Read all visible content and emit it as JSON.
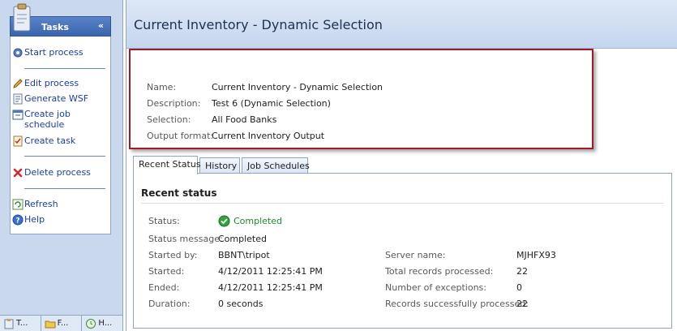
{
  "tasks": {
    "title": "Tasks",
    "collapse_glyph": "«",
    "items": [
      {
        "label": "Start process",
        "icon": "gear-icon"
      },
      {
        "label": "Edit process",
        "icon": "pencil-icon"
      },
      {
        "label": "Generate WSF",
        "icon": "script-icon"
      },
      {
        "label": "Create job",
        "label2": "schedule",
        "icon": "calendar-icon"
      },
      {
        "label": "Create task",
        "icon": "task-icon"
      },
      {
        "label": "Delete process",
        "icon": "delete-icon"
      },
      {
        "label": "Refresh",
        "icon": "refresh-icon"
      },
      {
        "label": "Help",
        "icon": "help-icon"
      }
    ]
  },
  "bottom_tabs": [
    {
      "label": "T..."
    },
    {
      "label": "F..."
    },
    {
      "label": "H..."
    }
  ],
  "main": {
    "title": "Current Inventory - Dynamic Selection",
    "properties": [
      {
        "key": "Name:",
        "value": "Current Inventory - Dynamic Selection"
      },
      {
        "key": "Description:",
        "value": "Test 6 (Dynamic Selection)"
      },
      {
        "key": "Selection:",
        "value": "All Food Banks"
      },
      {
        "key": "Output format:",
        "value": "Current Inventory Output"
      }
    ],
    "tabs": [
      {
        "label": "Recent Status"
      },
      {
        "label": "History"
      },
      {
        "label": "Job Schedules"
      }
    ],
    "recent": {
      "heading": "Recent status",
      "status_label": "Status:",
      "status_value": "Completed",
      "status_message_label": "Status message:",
      "status_message_value": "Completed",
      "left": [
        {
          "key": "Started by:",
          "value": "BBNT\\tripot"
        },
        {
          "key": "Started:",
          "value": "4/12/2011 12:25:41 PM"
        },
        {
          "key": "Ended:",
          "value": "4/12/2011 12:25:41 PM"
        },
        {
          "key": "Duration:",
          "value": "0 seconds"
        }
      ],
      "right": [
        {
          "key": "Server name:",
          "value": "MJHFX93"
        },
        {
          "key": "Total records processed:",
          "value": "22"
        },
        {
          "key": "Number of exceptions:",
          "value": "0"
        },
        {
          "key": "Records successfully processed:",
          "value": "22"
        }
      ]
    }
  },
  "colors": {
    "accent": "#3a64ad",
    "highlight_border": "#a01c22",
    "status_ok": "#1f8a2a",
    "link": "#1a3ea8"
  }
}
